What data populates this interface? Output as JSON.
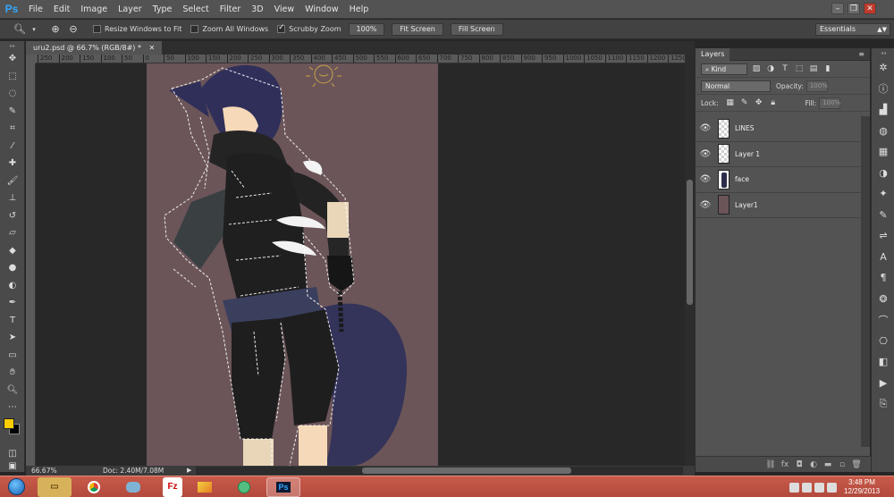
{
  "menubar": {
    "logo": "Ps",
    "items": [
      "File",
      "Edit",
      "Image",
      "Layer",
      "Type",
      "Select",
      "Filter",
      "3D",
      "View",
      "Window",
      "Help"
    ],
    "window_controls": [
      "–",
      "❐",
      "✕"
    ]
  },
  "options": {
    "resize_windows": "Resize Windows to Fit",
    "zoom_all": "Zoom All Windows",
    "scrubby_zoom": "Scrubby Zoom",
    "zoom_100": "100%",
    "fit_screen": "Fit Screen",
    "fill_screen": "Fill Screen",
    "workspace": "Essentials"
  },
  "document": {
    "tab_title": "uru2.psd @ 66.7% (RGB/8#) *",
    "tab_close": "✕",
    "ruler_ticks": [
      "250",
      "200",
      "150",
      "100",
      "50",
      "0",
      "50",
      "100",
      "150",
      "200",
      "250",
      "300",
      "350",
      "400",
      "450",
      "500",
      "550",
      "600",
      "650",
      "700",
      "750",
      "800",
      "850",
      "900",
      "950",
      "1000",
      "1050",
      "1100",
      "1150",
      "1200",
      "1250"
    ]
  },
  "status": {
    "zoom": "66.67%",
    "doc_size": "Doc: 2.40M/7.08M"
  },
  "layers_panel": {
    "tab": "Layers",
    "filter_kind": "Kind",
    "blend_mode": "Normal",
    "opacity_label": "Opacity:",
    "opacity_value": "100%",
    "lock_label": "Lock:",
    "fill_label": "Fill:",
    "fill_value": "100%",
    "layers": [
      {
        "name": "LINES",
        "thumb": "transparent"
      },
      {
        "name": "Layer 1",
        "thumb": "transparent"
      },
      {
        "name": "face",
        "thumb": "face"
      },
      {
        "name": "Layer1",
        "thumb": "solid"
      }
    ]
  },
  "taskbar": {
    "ps_label": "Ps",
    "clock_time": "3:48 PM",
    "clock_date": "12/29/2013"
  },
  "colors": {
    "foreground": "#ffcc00",
    "background": "#000000",
    "canvas_bg": "#6b5558",
    "accent": "#31a8ff"
  }
}
